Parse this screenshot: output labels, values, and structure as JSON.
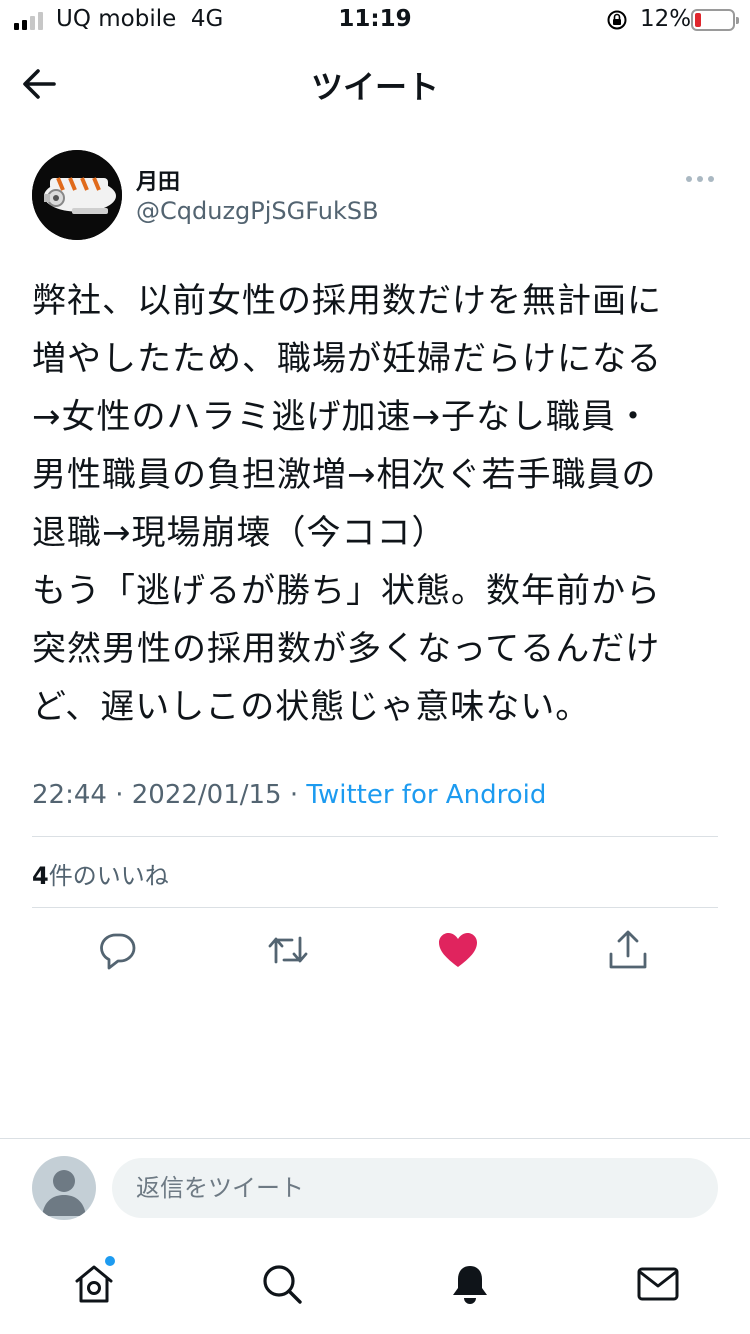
{
  "status_bar": {
    "carrier": "UQ mobile",
    "network": "4G",
    "time": "11:19",
    "battery_percent": "12%",
    "battery_level": 0.12,
    "battery_color": "#e0262d"
  },
  "header": {
    "title": "ツイート",
    "back_icon": "arrow-left-icon"
  },
  "tweet": {
    "author": {
      "display_name": "月田",
      "handle": "@CqduzgPjSGFukSB"
    },
    "text_lines": [
      "弊社、以前女性の採用数だけを無計画に",
      "増やしたため、職場が妊婦だらけになる",
      "→女性のハラミ逃げ加速→子なし職員・",
      "男性職員の負担激増→相次ぐ若手職員の",
      "退職→現場崩壊（今ココ）",
      "もう「逃げるが勝ち」状態。数年前から",
      "突然男性の採用数が多くなってるんだけ",
      "ど、遅いしこの状態じゃ意味ない。"
    ],
    "time": "22:44",
    "date": "2022/01/15",
    "source": "Twitter for Android",
    "likes_count": "4",
    "likes_label": "件のいいね",
    "liked": true,
    "like_color": "#e0245e"
  },
  "actions": {
    "reply_icon": "speech-bubble-icon",
    "retweet_icon": "retweet-icon",
    "like_icon": "heart-icon",
    "share_icon": "share-icon"
  },
  "composer": {
    "placeholder": "返信をツイート"
  },
  "bottom_nav": {
    "items": [
      "home-icon",
      "search-icon",
      "bell-icon",
      "mail-icon"
    ],
    "home_has_notification": true,
    "accent": "#1d9bf0"
  }
}
